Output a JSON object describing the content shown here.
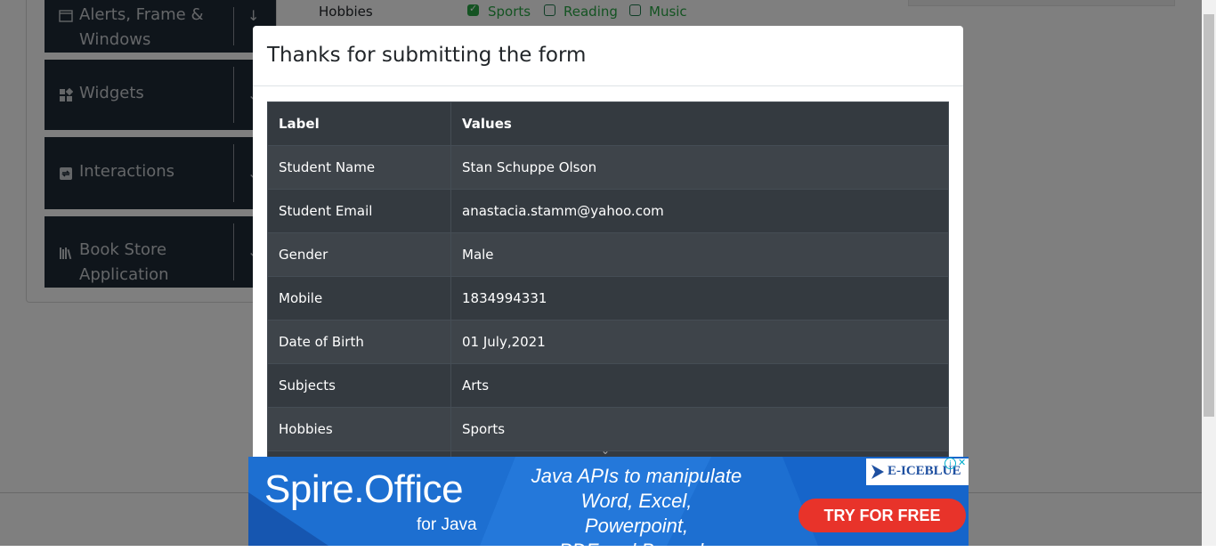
{
  "sidebar": {
    "groups": [
      {
        "label_line1": "Alerts, Frame &",
        "label_line2": "Windows",
        "icon": "window-icon"
      },
      {
        "label_line1": "Widgets",
        "label_line2": "",
        "icon": "widgets-icon"
      },
      {
        "label_line1": "Interactions",
        "label_line2": "",
        "icon": "interactions-icon"
      },
      {
        "label_line1": "Book Store",
        "label_line2": "Application",
        "icon": "books-icon"
      }
    ]
  },
  "form": {
    "hobbies_label": "Hobbies",
    "hobbies": [
      {
        "label": "Sports",
        "checked": true
      },
      {
        "label": "Reading",
        "checked": false
      },
      {
        "label": "Music",
        "checked": false
      }
    ]
  },
  "modal": {
    "title": "Thanks for submitting the form",
    "table": {
      "headers": [
        "Label",
        "Values"
      ],
      "rows": [
        {
          "label": "Student Name",
          "value": "Stan Schuppe Olson"
        },
        {
          "label": "Student Email",
          "value": "anastacia.stamm@yahoo.com"
        },
        {
          "label": "Gender",
          "value": "Male"
        },
        {
          "label": "Mobile",
          "value": "1834994331"
        },
        {
          "label": "Date of Birth",
          "value": "01 July,2021"
        },
        {
          "label": "Subjects",
          "value": "Arts"
        },
        {
          "label": "Hobbies",
          "value": "Sports"
        }
      ]
    }
  },
  "ad": {
    "title": "Spire.Office",
    "subtitle": "for Java",
    "line1": "Java APIs to manipulate",
    "line2": "Word, Excel, Powerpoint,",
    "line3": "PDF and Barcode",
    "cta": "TRY FOR FREE",
    "brand": "E-ICEBLUE"
  },
  "colors": {
    "backdrop": "#808080",
    "sidebar_bg": "#1f2a36",
    "table_dark": "#343a40",
    "checkbox_green": "#28a745",
    "ad_blue": "#1d6fd1",
    "cta_red": "#e8332a"
  }
}
